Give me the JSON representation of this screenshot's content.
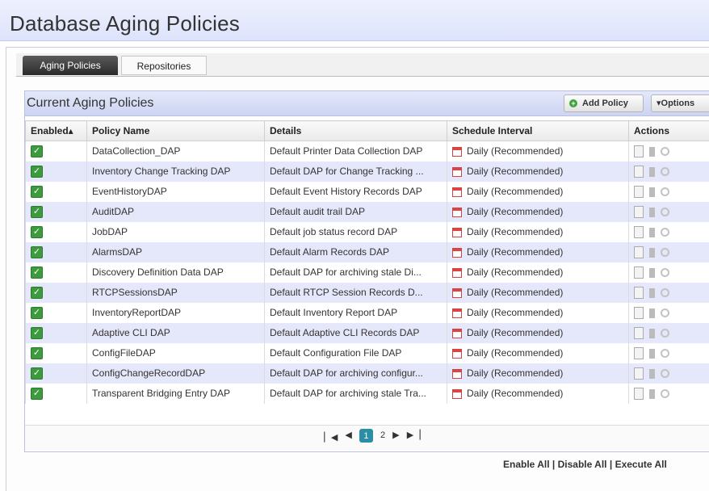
{
  "page": {
    "title": "Database Aging Policies"
  },
  "tabs": [
    {
      "label": "Aging Policies",
      "active": true
    },
    {
      "label": "Repositories",
      "active": false
    }
  ],
  "panel": {
    "title": "Current Aging Policies",
    "add_label": "Add Policy",
    "options_label": "▾Options"
  },
  "columns": {
    "enabled": "Enabled▴",
    "name": "Policy Name",
    "details": "Details",
    "schedule": "Schedule Interval",
    "actions": "Actions"
  },
  "rows": [
    {
      "enabled": true,
      "name": "DataCollection_DAP",
      "details": "Default Printer Data Collection DAP",
      "schedule": "Daily (Recommended)"
    },
    {
      "enabled": true,
      "name": "Inventory Change Tracking DAP",
      "details": "Default DAP for Change Tracking ...",
      "schedule": "Daily (Recommended)"
    },
    {
      "enabled": true,
      "name": "EventHistoryDAP",
      "details": "Default Event History Records DAP",
      "schedule": "Daily (Recommended)"
    },
    {
      "enabled": true,
      "name": "AuditDAP",
      "details": "Default audit trail DAP",
      "schedule": "Daily (Recommended)"
    },
    {
      "enabled": true,
      "name": "JobDAP",
      "details": "Default job status record DAP",
      "schedule": "Daily (Recommended)"
    },
    {
      "enabled": true,
      "name": "AlarmsDAP",
      "details": "Default Alarm Records DAP",
      "schedule": "Daily (Recommended)"
    },
    {
      "enabled": true,
      "name": "Discovery Definition Data DAP",
      "details": "Default DAP for archiving stale Di...",
      "schedule": "Daily (Recommended)"
    },
    {
      "enabled": true,
      "name": "RTCPSessionsDAP",
      "details": "Default RTCP Session Records D...",
      "schedule": "Daily (Recommended)"
    },
    {
      "enabled": true,
      "name": "InventoryReportDAP",
      "details": "Default Inventory Report DAP",
      "schedule": "Daily (Recommended)"
    },
    {
      "enabled": true,
      "name": "Adaptive CLI DAP",
      "details": "Default Adaptive CLI Records DAP",
      "schedule": "Daily (Recommended)"
    },
    {
      "enabled": true,
      "name": "ConfigFileDAP",
      "details": "Default Configuration File DAP",
      "schedule": "Daily (Recommended)"
    },
    {
      "enabled": true,
      "name": "ConfigChangeRecordDAP",
      "details": "Default DAP for archiving configur...",
      "schedule": "Daily (Recommended)"
    },
    {
      "enabled": true,
      "name": "Transparent Bridging Entry DAP",
      "details": "Default DAP for archiving stale Tra...",
      "schedule": "Daily (Recommended)"
    }
  ],
  "pager": {
    "first": "▏◀",
    "prev": "◀",
    "pages": [
      "1",
      "2"
    ],
    "current": "1",
    "next": "▶",
    "last": "▶▕"
  },
  "footer": {
    "enable_all": "Enable All",
    "disable_all": "Disable All",
    "execute_all": "Execute All",
    "sep": " | "
  },
  "icons": {
    "checkbox": "check-icon",
    "schedule": "calendar-icon",
    "edit": "edit-icon",
    "delete": "delete-icon",
    "execute": "execute-icon"
  },
  "colors": {
    "header_bg": "#dde3fb",
    "row_alt": "#e5e7fa",
    "check": "#3e9a3e",
    "page_current": "#2a8ea4"
  }
}
